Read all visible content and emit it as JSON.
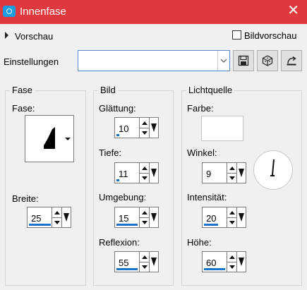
{
  "window": {
    "title": "Innenfase",
    "accent_color": "#e0393e",
    "icon": "camera-icon",
    "close_icon": "close-icon"
  },
  "preview": {
    "label": "Vorschau",
    "checkbox_label": "Bildvorschau",
    "checked": false
  },
  "settings": {
    "label": "Einstellungen",
    "value": "",
    "buttons": [
      "save-icon",
      "randomize-icon",
      "reset-icon"
    ]
  },
  "fase_group": {
    "title": "Fase",
    "shape_label": "Fase:",
    "width_label": "Breite:",
    "width_value": "25"
  },
  "bild_group": {
    "title": "Bild",
    "smoothing_label": "Glättung:",
    "smoothing_value": "10",
    "depth_label": "Tiefe:",
    "depth_value": "11",
    "ambience_label": "Umgebung:",
    "ambience_value": "15",
    "reflection_label": "Reflexion:",
    "reflection_value": "55"
  },
  "light_group": {
    "title": "Lichtquelle",
    "color_label": "Farbe:",
    "color_value": "#ffffff",
    "angle_label": "Winkel:",
    "angle_value": "9",
    "intensity_label": "Intensität:",
    "intensity_value": "20",
    "height_label": "Höhe:",
    "height_value": "60"
  }
}
